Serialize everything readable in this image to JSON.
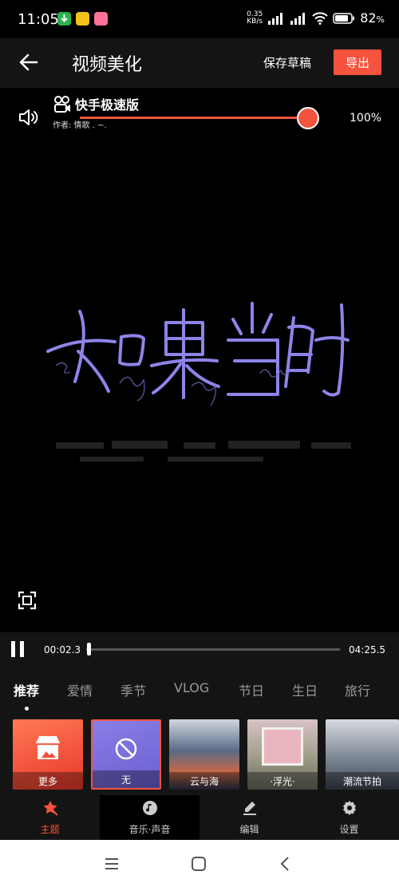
{
  "status_bar": {
    "time": "11:05",
    "net_speed_value": "0.35",
    "net_speed_unit": "KB/s",
    "battery_percent": "82",
    "battery_unit": "%"
  },
  "header": {
    "title": "视频美化",
    "save_draft_label": "保存草稿",
    "export_label": "导出"
  },
  "preview": {
    "app_badge_name": "快手极速版",
    "author": "作者: 情歌 . ~.",
    "volume_percent_label": "100%",
    "volume_level": 1.0
  },
  "playback": {
    "current_time": "00:02.3",
    "total_time": "04:25.5",
    "progress": 0.009
  },
  "tabs": [
    {
      "label": "推荐",
      "active": true
    },
    {
      "label": "爱情"
    },
    {
      "label": "季节"
    },
    {
      "label": "VLOG"
    },
    {
      "label": "节日"
    },
    {
      "label": "生日"
    },
    {
      "label": "旅行"
    }
  ],
  "themes": [
    {
      "label": "更多"
    },
    {
      "label": "无"
    },
    {
      "label": "云与海"
    },
    {
      "label": "·浮光·"
    },
    {
      "label": "潮流节拍"
    }
  ],
  "bottom_nav": [
    {
      "label": "主题",
      "icon": "theme-icon"
    },
    {
      "label": "音乐·声音",
      "icon": "music-icon"
    },
    {
      "label": "编辑",
      "icon": "edit-icon"
    },
    {
      "label": "设置",
      "icon": "settings-icon"
    }
  ],
  "colors": {
    "accent": "#f5533d",
    "panel": "#141414"
  }
}
